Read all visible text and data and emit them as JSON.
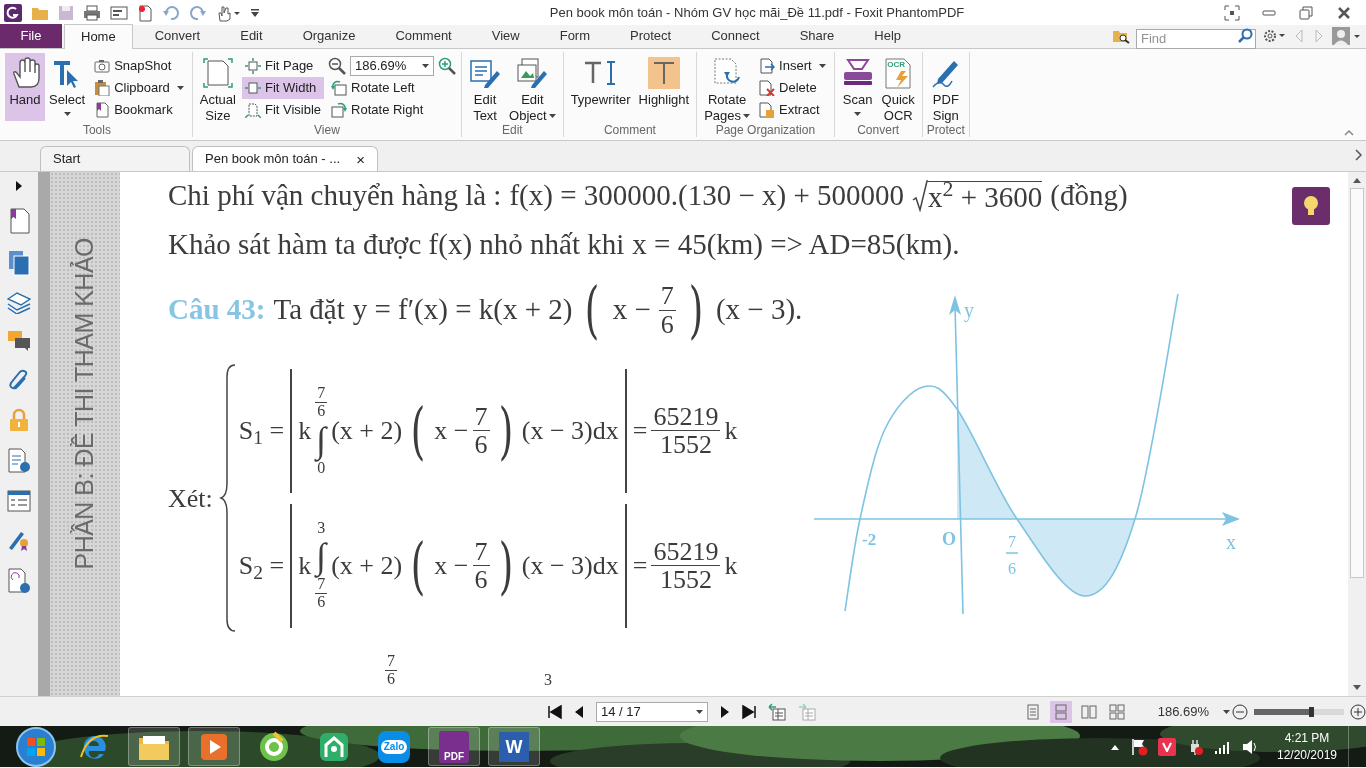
{
  "window": {
    "title": "Pen book môn toán - Nhóm GV học mãi_Đề 11.pdf - Foxit PhantomPDF"
  },
  "menu_tabs": [
    {
      "label": "File",
      "kind": "file",
      "selected": false
    },
    {
      "label": "Home",
      "kind": "tab",
      "selected": true
    },
    {
      "label": "Convert",
      "kind": "tab",
      "selected": false
    },
    {
      "label": "Edit",
      "kind": "tab",
      "selected": false
    },
    {
      "label": "Organize",
      "kind": "tab",
      "selected": false
    },
    {
      "label": "Comment",
      "kind": "tab",
      "selected": false
    },
    {
      "label": "View",
      "kind": "tab",
      "selected": false
    },
    {
      "label": "Form",
      "kind": "tab",
      "selected": false
    },
    {
      "label": "Protect",
      "kind": "tab",
      "selected": false
    },
    {
      "label": "Connect",
      "kind": "tab",
      "selected": false
    },
    {
      "label": "Share",
      "kind": "tab",
      "selected": false
    },
    {
      "label": "Help",
      "kind": "tab",
      "selected": false
    }
  ],
  "search": {
    "placeholder": "Find"
  },
  "ribbon": {
    "groups": [
      {
        "label": "Tools",
        "items": [
          {
            "kind": "large",
            "lines": [
              "Hand"
            ],
            "selected": true,
            "dropdown": false
          },
          {
            "kind": "large",
            "lines": [
              "Select"
            ],
            "selected": false,
            "dropdown": true
          },
          {
            "kind": "stack",
            "buttons": [
              {
                "kind": "button",
                "label": "SnapShot",
                "selected": false,
                "dropdown": false
              },
              {
                "kind": "button",
                "label": "Clipboard",
                "selected": false,
                "dropdown": true
              },
              {
                "kind": "button",
                "label": "Bookmark",
                "selected": false,
                "dropdown": false
              }
            ]
          }
        ]
      },
      {
        "label": "View",
        "items": [
          {
            "kind": "large",
            "lines": [
              "Actual",
              "Size"
            ],
            "selected": false,
            "dropdown": false
          },
          {
            "kind": "stack",
            "buttons": [
              {
                "kind": "button",
                "label": "Fit Page",
                "selected": false,
                "dropdown": false
              },
              {
                "kind": "button",
                "label": "Fit Width",
                "selected": true,
                "dropdown": false
              },
              {
                "kind": "button",
                "label": "Fit Visible",
                "selected": false,
                "dropdown": false
              }
            ]
          },
          {
            "kind": "stack",
            "buttons": [
              {
                "kind": "zoom",
                "value": "186.69%"
              },
              {
                "kind": "button",
                "label": "Rotate Left",
                "selected": false,
                "dropdown": false
              },
              {
                "kind": "button",
                "label": "Rotate Right",
                "selected": false,
                "dropdown": false
              }
            ]
          }
        ]
      },
      {
        "label": "Edit",
        "items": [
          {
            "kind": "large",
            "lines": [
              "Edit",
              "Text"
            ],
            "selected": false,
            "dropdown": false
          },
          {
            "kind": "large",
            "lines": [
              "Edit",
              "Object"
            ],
            "selected": false,
            "dropdown": true
          }
        ]
      },
      {
        "label": "Comment",
        "items": [
          {
            "kind": "large",
            "lines": [
              "Typewriter"
            ],
            "selected": false,
            "dropdown": false
          },
          {
            "kind": "large",
            "lines": [
              "Highlight"
            ],
            "selected": false,
            "dropdown": false
          }
        ]
      },
      {
        "label": "Page Organization",
        "items": [
          {
            "kind": "large",
            "lines": [
              "Rotate",
              "Pages"
            ],
            "selected": false,
            "dropdown": true
          },
          {
            "kind": "stack",
            "buttons": [
              {
                "kind": "button",
                "label": "Insert",
                "selected": false,
                "dropdown": true
              },
              {
                "kind": "button",
                "label": "Delete",
                "selected": false,
                "dropdown": false
              },
              {
                "kind": "button",
                "label": "Extract",
                "selected": false,
                "dropdown": false
              }
            ]
          }
        ]
      },
      {
        "label": "Convert",
        "items": [
          {
            "kind": "large",
            "lines": [
              "Scan"
            ],
            "selected": false,
            "dropdown": true
          },
          {
            "kind": "large",
            "lines": [
              "Quick",
              "OCR"
            ],
            "selected": false,
            "dropdown": false,
            "badge": "OCR"
          }
        ]
      },
      {
        "label": "Protect",
        "items": [
          {
            "kind": "large",
            "lines": [
              "PDF",
              "Sign"
            ],
            "selected": false,
            "dropdown": false
          }
        ]
      }
    ]
  },
  "doc_tabs": [
    {
      "label": "Start",
      "selected": false,
      "closable": false
    },
    {
      "label": "Pen book môn toán - ...",
      "selected": true,
      "closable": true,
      "close": "×"
    }
  ],
  "document": {
    "side_heading": "PHẦN B: ĐỀ THI THAM KHẢO",
    "lines": [
      [
        {
          "t": "Chi phí vận chuyển hàng là :"
        },
        {
          "t": "f(x) = 300000.(130 − x) + 500000"
        },
        {
          "kind": "sqrt",
          "t": "x$^{2}$ + 3600"
        },
        {
          "t": "(đồng)"
        }
      ],
      [
        {
          "t": "Khảo sát hàm ta được f(x) nhỏ nhất khi"
        },
        {
          "t": "x = 45(km) => AD=85(km)."
        }
      ],
      [
        {
          "kind": "label",
          "t": "Câu 43:"
        },
        {
          "t": "Ta đặt"
        },
        {
          "t": "y = f′(x) = k(x + 2)"
        },
        {
          "kind": "delim",
          "t": "("
        },
        {
          "t": "x −"
        },
        {
          "kind": "frac",
          "num": "7",
          "den": "6"
        },
        {
          "kind": "delim",
          "t": ")"
        },
        {
          "t": "(x − 3)."
        }
      ]
    ],
    "system": {
      "label": "Xét:",
      "rows": [
        [
          {
            "t": "S$_{1}$ ="
          },
          {
            "kind": "bar"
          },
          {
            "t": "k"
          },
          {
            "kind": "int",
            "t": "∫",
            "upper": {
              "num": "7",
              "den": "6"
            },
            "lower": "0"
          },
          {
            "t": "(x + 2)"
          },
          {
            "kind": "delim",
            "t": "("
          },
          {
            "t": "x −"
          },
          {
            "kind": "frac",
            "num": "7",
            "den": "6"
          },
          {
            "kind": "delim",
            "t": ")"
          },
          {
            "t": "(x − 3)dx"
          },
          {
            "kind": "bar"
          },
          {
            "t": "="
          },
          {
            "kind": "frac",
            "num": "65219",
            "den": "1552"
          },
          {
            "t": "k"
          }
        ],
        [
          {
            "t": "S$_{2}$ ="
          },
          {
            "kind": "bar"
          },
          {
            "t": "k"
          },
          {
            "kind": "int",
            "t": "∫",
            "upper": "3",
            "lower": {
              "num": "7",
              "den": "6"
            }
          },
          {
            "t": "(x + 2)"
          },
          {
            "kind": "delim",
            "t": "("
          },
          {
            "t": "x −"
          },
          {
            "kind": "frac",
            "num": "7",
            "den": "6"
          },
          {
            "kind": "delim",
            "t": ")"
          },
          {
            "t": "(x − 3)dx"
          },
          {
            "kind": "bar"
          },
          {
            "t": "="
          },
          {
            "kind": "frac",
            "num": "65219",
            "den": "1552"
          },
          {
            "t": "k"
          }
        ]
      ]
    },
    "graph": {
      "y_label": "y",
      "x_label": "x",
      "left_root": "-2",
      "origin": "O",
      "middle_root": {
        "num": "7",
        "den": "6"
      }
    },
    "partial_limits": [
      {
        "kind": "frac",
        "num": "7",
        "den": "6"
      },
      {
        "t": "3"
      }
    ]
  },
  "status_bar": {
    "page": "14 / 17",
    "view_modes": [
      {
        "selected": false
      },
      {
        "selected": true
      },
      {
        "selected": false
      },
      {
        "selected": false
      }
    ],
    "zoom": "186.69%",
    "zoom_slider": {
      "level": 0.64
    }
  },
  "taskbar": {
    "apps": [
      {
        "running": false
      },
      {
        "running": true
      },
      {
        "running": true
      },
      {
        "running": false
      },
      {
        "running": false
      },
      {
        "running": false,
        "label": "Zalo"
      },
      {
        "running": true,
        "label": "PDF"
      },
      {
        "running": true,
        "label": "W"
      }
    ],
    "time": "4:21 PM",
    "date": "12/20/2019"
  }
}
